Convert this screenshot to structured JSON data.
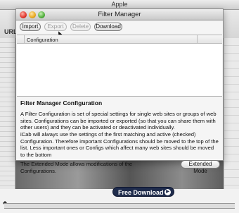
{
  "background_window": {
    "title": "Apple",
    "url_label": "URL",
    "free_download_label": "Free Download"
  },
  "dialog": {
    "title": "Filter Manager",
    "toolbar": {
      "import_label": "Import",
      "export_label": "Export",
      "delete_label": "Delete",
      "download_label": "Download"
    },
    "list": {
      "column_header": "Configuration"
    },
    "info": {
      "heading": "Filter Manager Configuration",
      "paragraph1": "A Filter Configuration is set of special settings for single web sites or groups of web sites. Configurations can be imported or exported (so that you can share them with other users) and they can be activated or deactivated individually.",
      "paragraph2": "iCab will always use the settings of the first matching and active (checked) Configuration. Therefore important Configurations should be moved to the top of the list. Less important ones or Configs which affect many web sites should be moved to the bottom",
      "paragraph3": "The Extended Mode allows modifications of the Configurations.",
      "extended_mode_label": "Extended Mode"
    }
  }
}
